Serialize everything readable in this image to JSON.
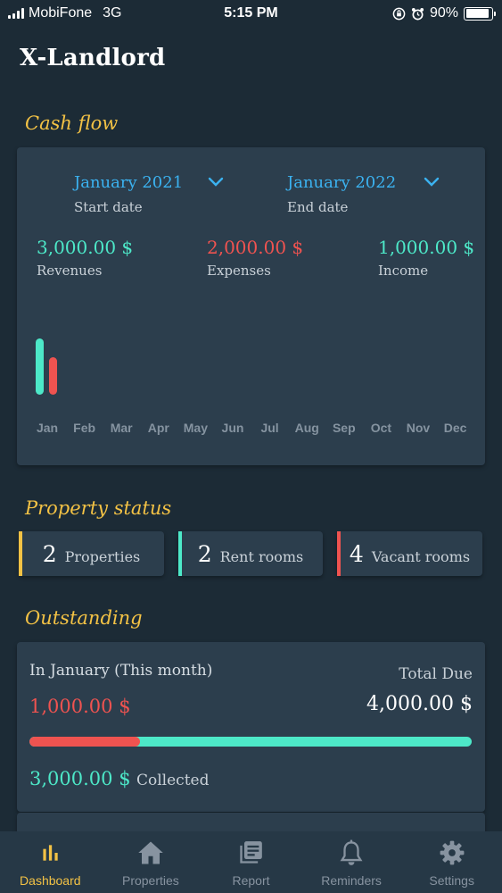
{
  "status_bar": {
    "carrier": "MobiFone",
    "network": "3G",
    "time": "5:15 PM",
    "battery": "90%",
    "battery_level": 0.9
  },
  "app": {
    "title": "X-Landlord"
  },
  "cash_flow": {
    "title": "Cash flow",
    "start": {
      "value": "January 2021",
      "label": "Start date"
    },
    "end": {
      "value": "January 2022",
      "label": "End date"
    },
    "revenues": {
      "value": "3,000.00 $",
      "label": "Revenues"
    },
    "expenses": {
      "value": "2,000.00 $",
      "label": "Expenses"
    },
    "income": {
      "value": "1,000.00 $",
      "label": "Income"
    }
  },
  "chart_data": {
    "type": "bar",
    "categories": [
      "Jan",
      "Feb",
      "Mar",
      "Apr",
      "May",
      "Jun",
      "Jul",
      "Aug",
      "Sep",
      "Oct",
      "Nov",
      "Dec"
    ],
    "series": [
      {
        "values": [
          3000,
          0,
          0,
          0,
          0,
          0,
          0,
          0,
          0,
          0,
          0,
          0
        ],
        "color": "#4de8c8"
      },
      {
        "values": [
          2000,
          0,
          0,
          0,
          0,
          0,
          0,
          0,
          0,
          0,
          0,
          0
        ],
        "color": "#ef5350"
      }
    ],
    "ylim": [
      0,
      3000
    ],
    "grid": false
  },
  "property_status": {
    "title": "Property status",
    "items": [
      {
        "count": "2",
        "label": "Properties",
        "color": "#f3c245"
      },
      {
        "count": "2",
        "label": "Rent rooms",
        "color": "#4de8c8"
      },
      {
        "count": "4",
        "label": "Vacant rooms",
        "color": "#ef5350"
      }
    ]
  },
  "outstanding": {
    "title": "Outstanding",
    "period": "In January (This month)",
    "total_due_label": "Total Due",
    "outstanding_amount": "1,000.00 $",
    "total_due": "4,000.00 $",
    "collected_amount": "3,000.00 $",
    "collected_label": "Collected",
    "outstanding_fraction": 0.25
  },
  "colors": {
    "accent": "#f3c245",
    "revenue": "#4de8c8",
    "expense": "#ef5350",
    "date": "#3bb2f0"
  },
  "tabs": [
    {
      "label": "Dashboard",
      "icon": "bar-chart-icon",
      "active": true
    },
    {
      "label": "Properties",
      "icon": "home-icon",
      "active": false
    },
    {
      "label": "Report",
      "icon": "report-icon",
      "active": false
    },
    {
      "label": "Reminders",
      "icon": "bell-icon",
      "active": false
    },
    {
      "label": "Settings",
      "icon": "gear-icon",
      "active": false
    }
  ]
}
